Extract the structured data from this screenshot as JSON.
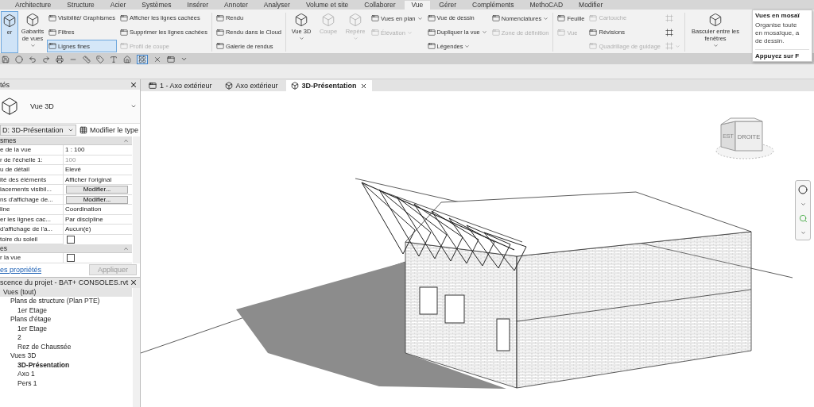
{
  "ribbon_tabs": [
    {
      "label": "Architecture",
      "selected": false
    },
    {
      "label": "Structure",
      "selected": false
    },
    {
      "label": "Acier",
      "selected": false
    },
    {
      "label": "Systèmes",
      "selected": false
    },
    {
      "label": "Insérer",
      "selected": false
    },
    {
      "label": "Annoter",
      "selected": false
    },
    {
      "label": "Analyser",
      "selected": false
    },
    {
      "label": "Volume et site",
      "selected": false
    },
    {
      "label": "Collaborer",
      "selected": false
    },
    {
      "label": "Vue",
      "selected": true
    },
    {
      "label": "Gérer",
      "selected": false
    },
    {
      "label": "Compléments",
      "selected": false
    },
    {
      "label": "MethoCAD",
      "selected": false
    },
    {
      "label": "Modifier",
      "selected": false
    }
  ],
  "ribbon": [
    {
      "kind": "large",
      "label": "er",
      "on": true,
      "disabled": false,
      "menu": false
    },
    {
      "kind": "large",
      "label": "Gabarits de vues",
      "on": false,
      "disabled": false,
      "menu": true
    },
    {
      "kind": "stack",
      "items": [
        {
          "label": "Visibilité/ Graphismes",
          "on": false,
          "disabled": false,
          "menu": false
        },
        {
          "label": "Filtres",
          "on": false,
          "disabled": false,
          "menu": false
        },
        {
          "label": "Lignes fines",
          "on": true,
          "disabled": false,
          "menu": false
        }
      ]
    },
    {
      "kind": "stack",
      "items": [
        {
          "label": "Afficher les lignes cachées",
          "on": false,
          "disabled": false,
          "menu": false
        },
        {
          "label": "Supprimer les lignes cachées",
          "on": false,
          "disabled": false,
          "menu": false
        },
        {
          "label": "Profil de coupe",
          "on": false,
          "disabled": true,
          "menu": false
        }
      ]
    },
    {
      "kind": "divider"
    },
    {
      "kind": "stack",
      "items": [
        {
          "label": "Rendu",
          "on": false,
          "disabled": false,
          "menu": false
        },
        {
          "label": "Rendu  dans le Cloud",
          "on": false,
          "disabled": false,
          "menu": false
        },
        {
          "label": "Galerie  de rendus",
          "on": false,
          "disabled": false,
          "menu": false
        }
      ]
    },
    {
      "kind": "divider"
    },
    {
      "kind": "large",
      "label": "Vue 3D",
      "on": false,
      "disabled": false,
      "menu": true
    },
    {
      "kind": "large",
      "label": "Coupe",
      "on": false,
      "disabled": true,
      "menu": false
    },
    {
      "kind": "large",
      "label": "Repère",
      "on": false,
      "disabled": true,
      "menu": true
    },
    {
      "kind": "stack",
      "items": [
        {
          "label": "Vues en plan",
          "on": false,
          "disabled": false,
          "menu": true
        },
        {
          "label": "Élévation",
          "on": false,
          "disabled": true,
          "menu": true
        }
      ]
    },
    {
      "kind": "stack",
      "items": [
        {
          "label": "Vue de dessin",
          "on": false,
          "disabled": false,
          "menu": false
        },
        {
          "label": "Dupliquer la vue",
          "on": false,
          "disabled": false,
          "menu": true
        },
        {
          "label": "Légendes",
          "on": false,
          "disabled": false,
          "menu": true
        }
      ]
    },
    {
      "kind": "stack",
      "items": [
        {
          "label": "Nomenclatures",
          "on": false,
          "disabled": false,
          "menu": true
        },
        {
          "label": "Zone de définition",
          "on": false,
          "disabled": true,
          "menu": false
        }
      ]
    },
    {
      "kind": "divider"
    },
    {
      "kind": "stack",
      "items": [
        {
          "label": "Feuille",
          "on": false,
          "disabled": false,
          "menu": false
        },
        {
          "label": "Vue",
          "on": false,
          "disabled": true,
          "menu": false
        }
      ]
    },
    {
      "kind": "stack",
      "items": [
        {
          "label": "Cartouche",
          "on": false,
          "disabled": true,
          "menu": false
        },
        {
          "label": "Révisions",
          "on": false,
          "disabled": false,
          "menu": false
        },
        {
          "label": "Quadrillage de guidage",
          "on": false,
          "disabled": true,
          "menu": false
        }
      ]
    },
    {
      "kind": "icons",
      "items": [
        {
          "disabled": true,
          "menu": false
        },
        {
          "disabled": false,
          "menu": false
        },
        {
          "disabled": true,
          "menu": true
        }
      ]
    },
    {
      "kind": "divider"
    },
    {
      "kind": "large",
      "label": "Basculer entre les fenêtres",
      "on": false,
      "disabled": false,
      "menu": true
    }
  ],
  "tooltip": {
    "title": "Vues en mosaï",
    "lines": [
      "Organise toute",
      "en mosaïque, a",
      "de dessin."
    ],
    "hint": "Appuyez sur F"
  },
  "quick_access": {
    "thin_lines_on": true
  },
  "properties": {
    "title": "tés",
    "type_name": "Vue 3D",
    "instance": "D: 3D-Présentation",
    "edit_type": "Modifier le type",
    "groups": [
      {
        "label": "smes",
        "rows": [
          {
            "kind": "text",
            "label": "e de la vue",
            "value": "1 : 100",
            "disabled": false
          },
          {
            "kind": "text",
            "label": "r de l'échelle    1:",
            "value": "100",
            "disabled": true
          },
          {
            "kind": "text",
            "label": "u de détail",
            "value": "Elevé",
            "disabled": false
          },
          {
            "kind": "text",
            "label": "ité des éléments",
            "value": "Afficher l'original",
            "disabled": false
          },
          {
            "kind": "button",
            "label": "lacements visibil...",
            "value": "Modifier...",
            "disabled": false
          },
          {
            "kind": "button",
            "label": "ns d'affichage de...",
            "value": "Modifier...",
            "disabled": false
          },
          {
            "kind": "text",
            "label": "line",
            "value": "Coordination",
            "disabled": false
          },
          {
            "kind": "text",
            "label": "er les lignes cac...",
            "value": "Par discipline",
            "disabled": false
          },
          {
            "kind": "text",
            "label": "d'affichage de l'a...",
            "value": "Aucun(e)",
            "disabled": false
          },
          {
            "kind": "checkbox",
            "label": "toire du soleil",
            "checked": false
          }
        ]
      },
      {
        "label": "es",
        "rows": [
          {
            "kind": "checkbox",
            "label": "r la vue",
            "checked": false
          }
        ]
      }
    ],
    "help_link": "es propriétés",
    "apply": "Appliquer",
    "apply_disabled": true
  },
  "browser": {
    "title": "scence du projet - BAT+ CONSOLES.rvt",
    "tree": [
      {
        "label": "Vues (tout)",
        "selected": true,
        "current": false,
        "children": [
          {
            "label": "Plans de structure (Plan PTE)",
            "selected": false,
            "current": false,
            "children": [
              {
                "label": "1er Etage",
                "selected": false,
                "current": false
              }
            ]
          },
          {
            "label": "Plans d'étage",
            "selected": false,
            "current": false,
            "children": [
              {
                "label": "1er Etage",
                "selected": false,
                "current": false
              },
              {
                "label": "2",
                "selected": false,
                "current": false
              },
              {
                "label": "Rez de Chaussée",
                "selected": false,
                "current": false
              }
            ]
          },
          {
            "label": "Vues 3D",
            "selected": false,
            "current": false,
            "children": [
              {
                "label": "3D-Présentation",
                "selected": false,
                "current": true
              },
              {
                "label": "Axo 1",
                "selected": false,
                "current": false
              },
              {
                "label": "Pers 1",
                "selected": false,
                "current": false
              }
            ]
          }
        ]
      }
    ]
  },
  "view_tabs": [
    {
      "label": "1 - Axo extérieur",
      "kind": "sheet",
      "selected": false
    },
    {
      "label": "Axo extérieur",
      "kind": "model",
      "selected": false
    },
    {
      "label": "3D-Présentation",
      "kind": "model",
      "selected": true
    }
  ],
  "viewcube": {
    "front": "DROITE",
    "side": "EST"
  }
}
